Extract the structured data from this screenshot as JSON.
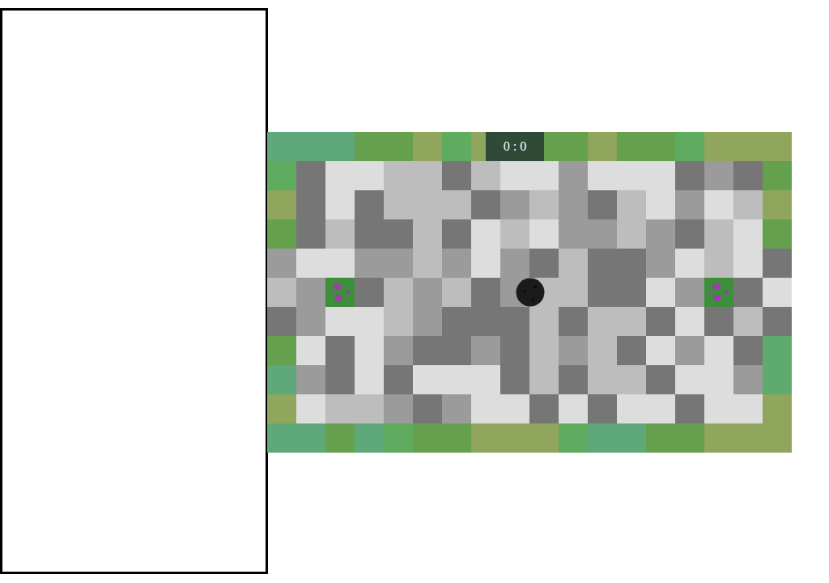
{
  "score": {
    "text": "0 : 0"
  },
  "side_panel": {
    "empty": true
  },
  "board": {
    "rows": [
      [
        "#5ea87a",
        "#5ea87a",
        "#5ea87a",
        "#64a04e",
        "#64a04e",
        "#8fa65c",
        "#5fab5f",
        "#8fa65c",
        "#64a04e",
        "#64a04e",
        "#64a04e",
        "#8fa65c",
        "#64a04e",
        "#64a04e",
        "#5fab5f",
        "#8fa65c",
        "#8fa65c",
        "#8fa65c"
      ],
      [
        "#5fab5f",
        "#767676",
        "#dcdddc",
        "#dcdddc",
        "#bdbdbd",
        "#bdbdbd",
        "#767676",
        "#bdbdbd",
        "#dcdddc",
        "#dcdddc",
        "#9b9b9b",
        "#dcdddc",
        "#dcdddc",
        "#dcdddc",
        "#767676",
        "#9b9b9b",
        "#767676",
        "#64a04e"
      ],
      [
        "#8fa65c",
        "#767676",
        "#dcdddc",
        "#767676",
        "#bdbdbd",
        "#bdbdbd",
        "#bdbdbd",
        "#767676",
        "#9b9b9b",
        "#bdbdbd",
        "#9b9b9b",
        "#767676",
        "#bdbdbd",
        "#dcdddc",
        "#9b9b9b",
        "#dcdddc",
        "#bdbdbd",
        "#8fa65c"
      ],
      [
        "#64a04e",
        "#767676",
        "#bdbdbd",
        "#767676",
        "#767676",
        "#bdbdbd",
        "#767676",
        "#dcdddc",
        "#bdbdbd",
        "#dcdddc",
        "#9b9b9b",
        "#9b9b9b",
        "#bdbdbd",
        "#9b9b9b",
        "#767676",
        "#bdbdbd",
        "#dcdddc",
        "#64a04e"
      ],
      [
        "#9b9b9b",
        "#dcdddc",
        "#dcdddc",
        "#9b9b9b",
        "#9b9b9b",
        "#bdbdbd",
        "#9b9b9b",
        "#dcdddc",
        "#9b9b9b",
        "#767676",
        "#bdbdbd",
        "#767676",
        "#767676",
        "#9b9b9b",
        "#dcdddc",
        "#bdbdbd",
        "#dcdddc",
        "#767676"
      ],
      [
        "#bdbdbd",
        "#9b9b9b",
        "goal",
        "#767676",
        "#bdbdbd",
        "#9b9b9b",
        "#bdbdbd",
        "#767676",
        "#9b9b9b",
        "#bdbdbd",
        "#bdbdbd",
        "#767676",
        "#767676",
        "#dcdddc",
        "#9b9b9b",
        "goal",
        "#767676",
        "#dcdddc"
      ],
      [
        "#767676",
        "#9b9b9b",
        "#dcdddc",
        "#dcdddc",
        "#bdbdbd",
        "#9b9b9b",
        "#767676",
        "#767676",
        "#767676",
        "#bdbdbd",
        "#767676",
        "#bdbdbd",
        "#bdbdbd",
        "#767676",
        "#dcdddc",
        "#767676",
        "#bdbdbd",
        "#767676"
      ],
      [
        "#64a04e",
        "#dcdddc",
        "#767676",
        "#dcdddc",
        "#9b9b9b",
        "#767676",
        "#767676",
        "#9b9b9b",
        "#767676",
        "#bdbdbd",
        "#9b9b9b",
        "#bdbdbd",
        "#767676",
        "#dcdddc",
        "#9b9b9b",
        "#dcdddc",
        "#767676",
        "#5fab6f"
      ],
      [
        "#5ea87a",
        "#9b9b9b",
        "#767676",
        "#dcdddc",
        "#767676",
        "#dcdddc",
        "#dcdddc",
        "#dcdddc",
        "#767676",
        "#bdbdbd",
        "#767676",
        "#bdbdbd",
        "#bdbdbd",
        "#767676",
        "#dcdddc",
        "#dcdddc",
        "#9b9b9b",
        "#5fab6f"
      ],
      [
        "#8fa65c",
        "#dcdddc",
        "#bdbdbd",
        "#bdbdbd",
        "#9b9b9b",
        "#767676",
        "#9b9b9b",
        "#dcdddc",
        "#dcdddc",
        "#767676",
        "#dcdddc",
        "#767676",
        "#dcdddc",
        "#dcdddc",
        "#767676",
        "#dcdddc",
        "#dcdddc",
        "#8fa65c"
      ],
      [
        "#5ea87a",
        "#5ea87a",
        "#64a04e",
        "#5ea87a",
        "#5fab5f",
        "#64a04e",
        "#64a04e",
        "#8fa65c",
        "#8fa65c",
        "#8fa65c",
        "#5fab5f",
        "#5ea87a",
        "#5ea87a",
        "#64a04e",
        "#64a04e",
        "#8fa65c",
        "#8fa65c",
        "#8fa65c"
      ]
    ]
  }
}
